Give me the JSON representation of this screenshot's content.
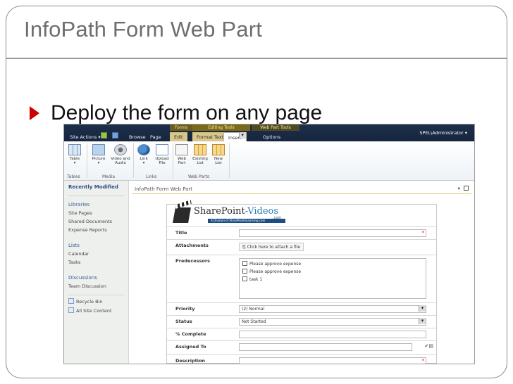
{
  "slide": {
    "title": "InfoPath Form Web Part",
    "bullet": "Deploy the form on any page"
  },
  "sharepoint": {
    "ribbon_top": {
      "site_actions": "Site Actions ▾",
      "tabs": [
        "Browse",
        "Page"
      ],
      "context_groups": [
        "Forms",
        "Editing Tools",
        "Web Part Tools"
      ],
      "context_tabs": [
        "Edit",
        "Format Text",
        "Insert",
        "Options"
      ],
      "selected_tab": "Insert",
      "user": "SPEL\\Administrator ▾"
    },
    "ribbon": {
      "buttons": [
        {
          "label": "Table",
          "sub": "▾"
        },
        {
          "label": "Picture",
          "sub": "▾"
        },
        {
          "label": "Video and",
          "sub": "Audio"
        },
        {
          "label": "Link",
          "sub": "▾"
        },
        {
          "label": "Upload",
          "sub": "File"
        },
        {
          "label": "Web",
          "sub": "Part"
        },
        {
          "label": "Existing",
          "sub": "List"
        },
        {
          "label": "New",
          "sub": "List"
        }
      ],
      "groups": [
        "Tables",
        "Media",
        "Links",
        "Web Parts"
      ]
    },
    "quick_launch": {
      "recently_modified": "Recently Modified",
      "libraries": "Libraries",
      "library_items": [
        "Site Pages",
        "Shared Documents",
        "Expense Reports"
      ],
      "lists": "Lists",
      "list_items": [
        "Calendar",
        "Tasks"
      ],
      "discussions": "Discussions",
      "discussion_items": [
        "Team Discussion"
      ],
      "footer_items": [
        "Recycle Bin",
        "All Site Content"
      ]
    },
    "webpart": {
      "title": "InfoPath Form Web Part",
      "menu_arrow": "▾"
    },
    "form": {
      "logo_text_a": "SharePoint",
      "logo_text_b": "-Videos",
      "logo_dotcom": ".com",
      "logo_tagline": "A Division of SharePointeLearning.com",
      "fields": {
        "title": "Title",
        "attachments": "Attachments",
        "attach_button": "Click here to attach a file",
        "predecessors": "Predecessors",
        "predecessor_options": [
          "Please approve expense",
          "Please approve expense",
          "task 1"
        ],
        "priority": "Priority",
        "priority_value": "(2) Normal",
        "status": "Status",
        "status_value": "Not Started",
        "percent_complete": "% Complete",
        "assigned_to": "Assigned To",
        "description": "Description",
        "required_mark": "*"
      }
    }
  }
}
